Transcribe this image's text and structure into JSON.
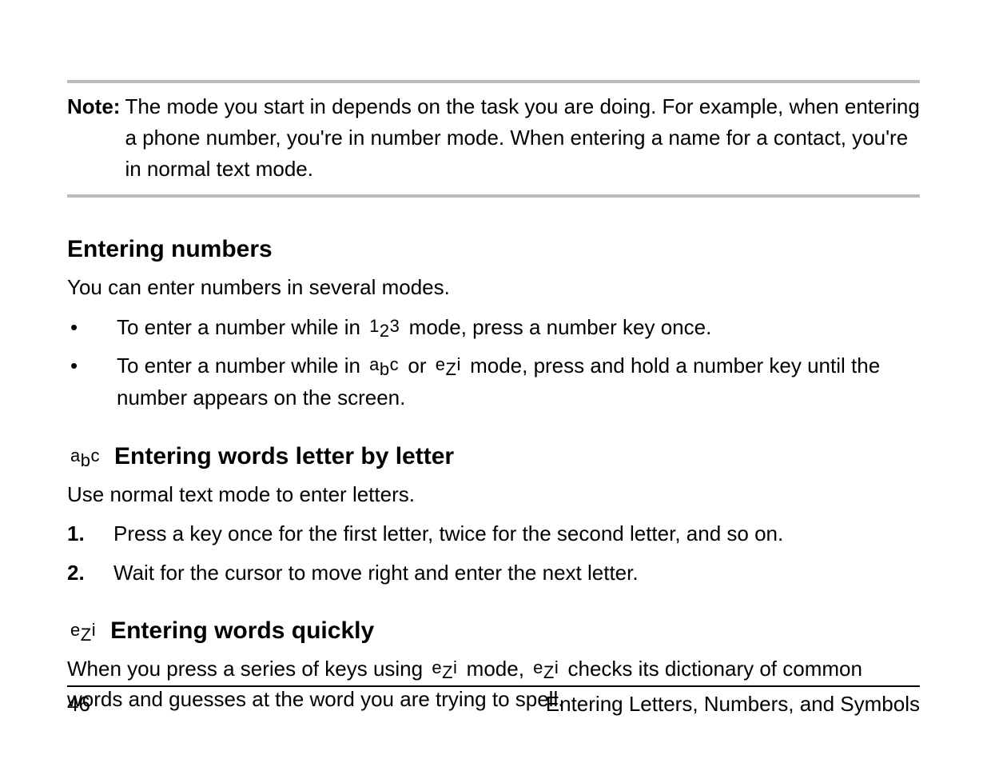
{
  "note": {
    "label": "Note:",
    "text": "The mode you start in depends on the task you are doing. For example, when entering a phone number, you're in number mode. When entering a name for a contact, you're in normal text mode."
  },
  "modes": {
    "num": {
      "c1": "1",
      "c2": "2",
      "c3": "3"
    },
    "abc": {
      "c1": "a",
      "c2": "b",
      "c3": "c"
    },
    "ezi": {
      "c1": "e",
      "c2": "Z",
      "c3": "i"
    }
  },
  "s1": {
    "heading": "Entering numbers",
    "intro": "You can enter numbers in several modes.",
    "bullet1_a": "To enter a number while in ",
    "bullet1_b": " mode, press a number key once.",
    "bullet2_a": "To enter a number while in ",
    "bullet2_b": " or ",
    "bullet2_c": " mode, press and hold a number key until the number appears on the screen."
  },
  "s2": {
    "heading": "Entering words letter by letter",
    "intro": "Use normal text mode to enter letters.",
    "step1": "Press a key once for the first letter, twice for the second letter, and so on.",
    "step2": "Wait for the cursor to move right and enter the next letter."
  },
  "s3": {
    "heading": "Entering words quickly",
    "p_a": "When you press a series of keys using ",
    "p_b": " mode, ",
    "p_c": " checks its dictionary of common words and guesses at the word you are trying to spell."
  },
  "footer": {
    "page": "46",
    "title": "Entering Letters, Numbers, and Symbols"
  }
}
